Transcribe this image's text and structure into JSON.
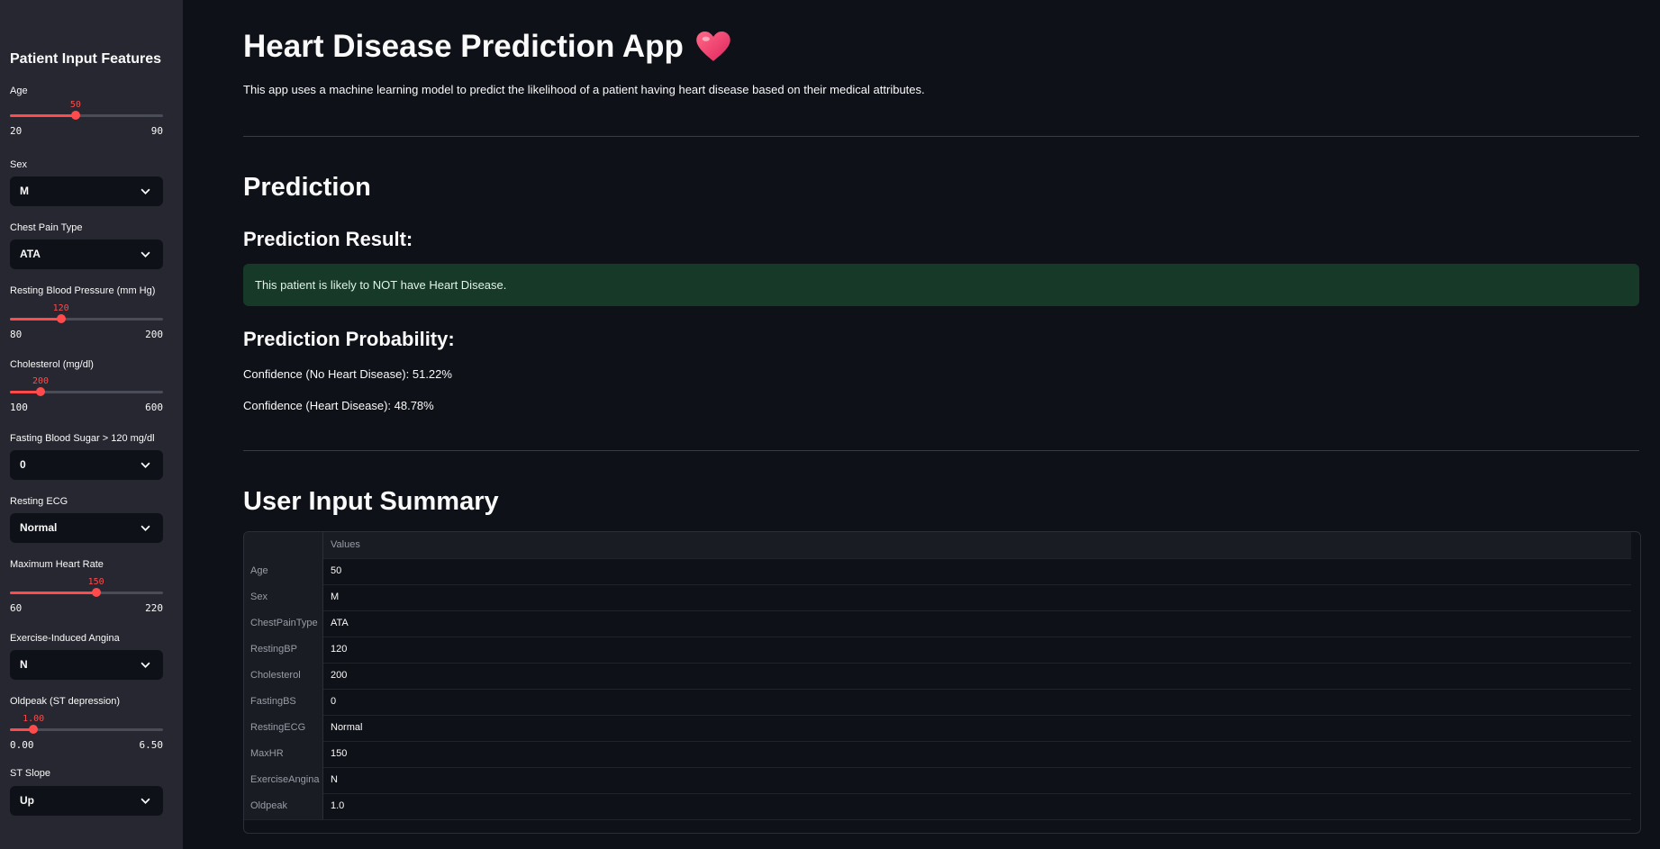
{
  "sidebar": {
    "title": "Patient Input Features",
    "age": {
      "label": "Age",
      "value": "50",
      "min": "20",
      "max": "90",
      "fraction": 0.4286
    },
    "sex": {
      "label": "Sex",
      "value": "M"
    },
    "chest_pain": {
      "label": "Chest Pain Type",
      "value": "ATA"
    },
    "resting_bp": {
      "label": "Resting Blood Pressure (mm Hg)",
      "value": "120",
      "min": "80",
      "max": "200",
      "fraction": 0.3333
    },
    "cholesterol": {
      "label": "Cholesterol (mg/dl)",
      "value": "200",
      "min": "100",
      "max": "600",
      "fraction": 0.2
    },
    "fasting_bs": {
      "label": "Fasting Blood Sugar > 120 mg/dl",
      "value": "0"
    },
    "resting_ecg": {
      "label": "Resting ECG",
      "value": "Normal"
    },
    "max_hr": {
      "label": "Maximum Heart Rate",
      "value": "150",
      "min": "60",
      "max": "220",
      "fraction": 0.5625
    },
    "angina": {
      "label": "Exercise-Induced Angina",
      "value": "N"
    },
    "oldpeak": {
      "label": "Oldpeak (ST depression)",
      "value": "1.00",
      "min": "0.00",
      "max": "6.50",
      "fraction": 0.1538
    },
    "st_slope": {
      "label": "ST Slope",
      "value": "Up"
    }
  },
  "main": {
    "title": "Heart Disease Prediction App",
    "intro": "This app uses a machine learning model to predict the likelihood of a patient having heart disease based on their medical attributes.",
    "prediction_heading": "Prediction",
    "result_heading": "Prediction Result:",
    "result_text": "This patient is likely to NOT have Heart Disease.",
    "probability_heading": "Prediction Probability:",
    "confidence_no": "Confidence (No Heart Disease): 51.22%",
    "confidence_yes": "Confidence (Heart Disease): 48.78%",
    "summary_heading": "User Input Summary",
    "table": {
      "column_header": "Values",
      "rows": [
        {
          "index": "Age",
          "value": "50"
        },
        {
          "index": "Sex",
          "value": "M"
        },
        {
          "index": "ChestPainType",
          "value": "ATA"
        },
        {
          "index": "RestingBP",
          "value": "120"
        },
        {
          "index": "Cholesterol",
          "value": "200"
        },
        {
          "index": "FastingBS",
          "value": "0"
        },
        {
          "index": "RestingECG",
          "value": "Normal"
        },
        {
          "index": "MaxHR",
          "value": "150"
        },
        {
          "index": "ExerciseAngina",
          "value": "N"
        },
        {
          "index": "Oldpeak",
          "value": "1.0"
        }
      ]
    }
  },
  "colors": {
    "accent": "#ff4b4b",
    "sidebar_bg": "#262730",
    "main_bg": "#0e1117",
    "success_bg": "#173928"
  },
  "icons": {
    "title_icon": "heart-icon",
    "select_icon": "chevron-down-icon"
  }
}
